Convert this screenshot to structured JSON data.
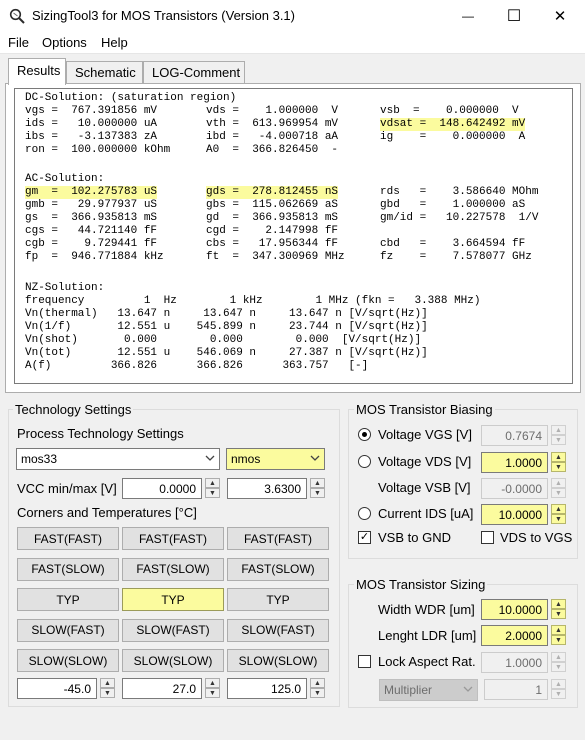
{
  "window": {
    "title": "SizingTool3 for MOS Transistors (Version 3.1)",
    "minimize_glyph": "—",
    "maximize_glyph": "☐",
    "close_glyph": "✕"
  },
  "menu": {
    "file": "File",
    "options": "Options",
    "help": "Help"
  },
  "tabs": {
    "results": "Results",
    "schematic": "Schematic",
    "log": "LOG-Comment"
  },
  "results": {
    "dc_header": "DC-Solution: (saturation region)",
    "dc_rows": [
      [
        "vgs =  767.391856 mV",
        "vds =    1.000000  V ",
        "vsb  =    0.000000  V"
      ],
      [
        "ids =   10.000000 uA",
        "vth =  613.969954 mV",
        "vdsat =  148.642492 mV"
      ],
      [
        "ibs =   -3.137383 zA",
        "ibd =   -4.000718 aA",
        "ig    =    0.000000  A"
      ],
      [
        "ron =  100.000000 kOhm",
        "A0  =  366.826450  -",
        ""
      ]
    ],
    "ac_header": "AC-Solution:",
    "ac_rows": [
      [
        "gm  =  102.275783 uS",
        "gds =  278.812455 nS",
        "rds   =    3.586640 MOhm"
      ],
      [
        "gmb =   29.977937 uS",
        "gbs =  115.062669 aS",
        "gbd   =    1.000000 aS"
      ],
      [
        "gs  =  366.935813 mS",
        "gd  =  366.935813 mS",
        "gm/id =   10.227578  1/V"
      ],
      [
        "cgs =   44.721140 fF",
        "cgd =    2.147998 fF",
        ""
      ],
      [
        "cgb =    9.729441 fF",
        "cbs =   17.956344 fF",
        "cbd   =    3.664594 fF"
      ],
      [
        "fp  =  946.771884 kHz",
        "ft  =  347.300969 MHz",
        "fz    =    7.578077 GHz"
      ]
    ],
    "nz_header": "NZ-Solution:",
    "nz_rows": [
      "frequency         1  Hz        1 kHz        1 MHz (fkn =   3.388 MHz)",
      "Vn(thermal)   13.647 n     13.647 n     13.647 n [V/sqrt(Hz)]",
      "Vn(1/f)       12.551 u    545.899 n     23.744 n [V/sqrt(Hz)]",
      "Vn(shot)       0.000        0.000        0.000  [V/sqrt(Hz)]",
      "Vn(tot)       12.551 u    546.069 n     27.387 n [V/sqrt(Hz)]",
      "A(f)         366.826      366.826      363.757   [-]"
    ]
  },
  "technology": {
    "group_title": "Technology Settings",
    "process_label": "Process Technology Settings",
    "process_value": "mos33",
    "type_value": "nmos",
    "vcc_label": "VCC min/max [V]",
    "vcc_min": "0.0000",
    "vcc_max": "3.6300",
    "corners_label": "Corners and Temperatures [°C]",
    "corner_rows": [
      [
        "FAST(FAST)",
        "FAST(FAST)",
        "FAST(FAST)"
      ],
      [
        "FAST(SLOW)",
        "FAST(SLOW)",
        "FAST(SLOW)"
      ],
      [
        "TYP",
        "TYP",
        "TYP"
      ],
      [
        "SLOW(FAST)",
        "SLOW(FAST)",
        "SLOW(FAST)"
      ],
      [
        "SLOW(SLOW)",
        "SLOW(SLOW)",
        "SLOW(SLOW)"
      ]
    ],
    "temps": [
      "-45.0",
      "27.0",
      "125.0"
    ]
  },
  "biasing": {
    "group_title": "MOS Transistor Biasing",
    "vgs_label": "Voltage VGS [V]",
    "vgs_value": "0.7674",
    "vds_label": "Voltage VDS [V]",
    "vds_value": "1.0000",
    "vsb_label": "Voltage VSB [V]",
    "vsb_value": "-0.0000",
    "ids_label": "Current IDS [uA]",
    "ids_value": "10.0000",
    "vsb_gnd_label": "VSB to GND",
    "vds_vgs_label": "VDS to VGS"
  },
  "sizing": {
    "group_title": "MOS Transistor Sizing",
    "wdr_label": "Width WDR [um]",
    "wdr_value": "10.0000",
    "ldr_label": "Lenght LDR [um]",
    "ldr_value": "2.0000",
    "lock_label": "Lock Aspect Rat.",
    "lock_value": "1.0000",
    "multiplier_label": "Multiplier",
    "multiplier_value": "1"
  },
  "colors": {
    "highlight": "#fbfb9e",
    "window_bg": "#f0f0f0"
  }
}
